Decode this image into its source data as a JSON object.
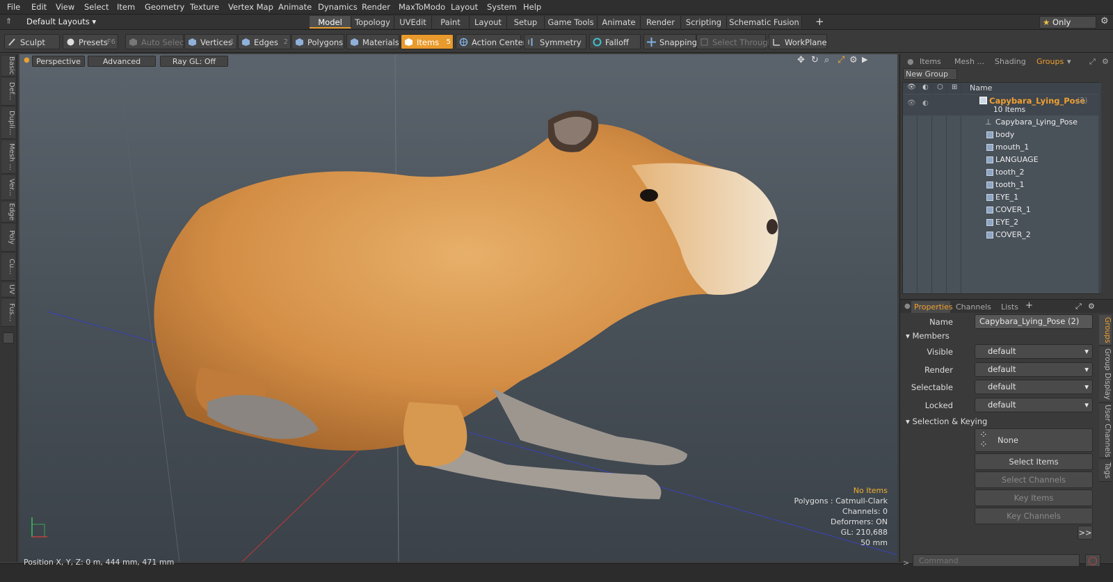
{
  "menu": [
    "File",
    "Edit",
    "View",
    "Select",
    "Item",
    "Geometry",
    "Texture",
    "Vertex Map",
    "Animate",
    "Dynamics",
    "Render",
    "MaxToModo",
    "Layout",
    "System",
    "Help"
  ],
  "layout_selector": "Default Layouts",
  "main_tabs": [
    "Model",
    "Topology",
    "UVEdit",
    "Paint",
    "Layout",
    "Setup",
    "Game Tools",
    "Animate",
    "Render",
    "Scripting",
    "Schematic Fusion"
  ],
  "only_label": "Only",
  "toolbar": {
    "sculpt": "Sculpt",
    "presets": "Presets",
    "presets_key": "F6",
    "auto_select": "Auto Select",
    "vertices": "Vertices",
    "vertices_key": "1",
    "edges": "Edges",
    "edges_key": "2",
    "polygons": "Polygons",
    "materials": "Materials",
    "items": "Items",
    "items_key": "5",
    "action_center": "Action Center",
    "symmetry": "Symmetry",
    "falloff": "Falloff",
    "snapping": "Snapping",
    "select_through": "Select Through",
    "workplane": "WorkPlane"
  },
  "left_tabs": [
    "Basic",
    "Def...",
    "Dupli...",
    "Mesh ...",
    "Ver...",
    "Edge",
    "Poly",
    "Cu...",
    "UV",
    "Fus..."
  ],
  "viewport": {
    "view": "Perspective",
    "shading": "Advanced",
    "raygl": "Ray GL: Off"
  },
  "hud": {
    "status": "No Items",
    "polygons": "Polygons : Catmull-Clark",
    "channels": "Channels: 0",
    "deformers": "Deformers: ON",
    "gl": "GL: 210,688",
    "unit": "50 mm"
  },
  "status": {
    "position": "Position X, Y, Z:   0 m, 444 mm, 471 mm"
  },
  "panel_tabs": [
    "Items",
    "Mesh ...",
    "Shading",
    "Groups"
  ],
  "new_group": "New Group",
  "tree_header": "Name",
  "group": {
    "name": "Capybara_Lying_Pose",
    "count": "(2)",
    "items_label": "10 Items"
  },
  "tree_items": [
    "Capybara_Lying_Pose",
    "body",
    "mouth_1",
    "LANGUAGE",
    "tooth_2",
    "tooth_1",
    "EYE_1",
    "COVER_1",
    "EYE_2",
    "COVER_2"
  ],
  "props_tabs": [
    "Properties",
    "Channels",
    "Lists"
  ],
  "props": {
    "name_label": "Name",
    "name_value": "Capybara_Lying_Pose (2)",
    "members": "Members",
    "visible": "Visible",
    "render": "Render",
    "selectable": "Selectable",
    "locked": "Locked",
    "dd_value": "default",
    "sel_keying": "Selection & Keying",
    "none": "None",
    "select_items": "Select Items",
    "select_channels": "Select Channels",
    "key_items": "Key Items",
    "key_channels": "Key Channels",
    "more": ">>"
  },
  "side_tabs": [
    "Groups",
    "Group Display",
    "User Channels",
    "Tags"
  ],
  "command_placeholder": "Command",
  "colors": {
    "accent": "#e89a2c",
    "fur": "#d9964a"
  }
}
